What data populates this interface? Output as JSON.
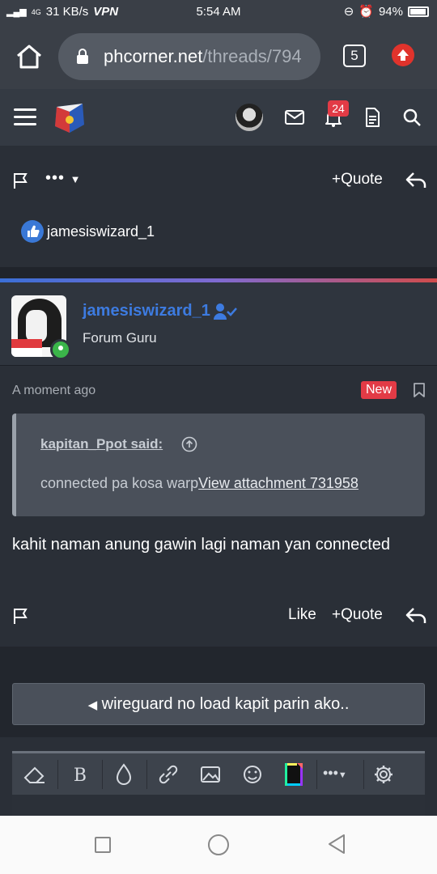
{
  "status_bar": {
    "network": "4G",
    "speed": "31 KB/s",
    "vpn": "VPN",
    "time": "5:54 AM",
    "battery": "94%"
  },
  "browser": {
    "url_domain": "phcorner.net",
    "url_path": "/threads/794",
    "tab_count": "5"
  },
  "navbar": {
    "notification_count": "24"
  },
  "post1": {
    "more_label": "•••",
    "quote_label": "Quote",
    "reactor_name": "jamesiswizard_1"
  },
  "post2": {
    "username": "jamesiswizard_1",
    "user_title": "Forum Guru",
    "timestamp": "A moment ago",
    "new_label": "New",
    "quote_author": "kapitan_Ppot said:",
    "quote_text": "connected pa kosa warp",
    "quote_link": "View attachment 731958",
    "body": "kahit naman anung gawin lagi naman yan connected",
    "like_label": "Like",
    "quote_label": "Quote"
  },
  "thread_nav": {
    "label": "wireguard no load kapit parin ako.."
  },
  "colors": {
    "accent_blue": "#3d7be0",
    "badge_red": "#e23b46",
    "online_green": "#3bb54a"
  }
}
